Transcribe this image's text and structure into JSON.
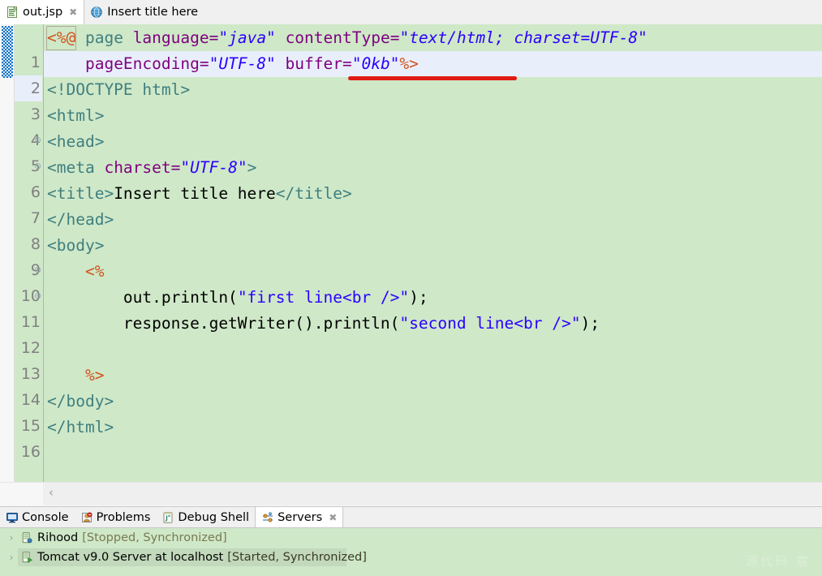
{
  "editor_tabs": [
    {
      "label": "out.jsp",
      "icon": "jsp-file-icon",
      "active": true,
      "close": "✖"
    },
    {
      "label": "Insert title here",
      "icon": "browser-globe-icon",
      "active": false,
      "close": ""
    }
  ],
  "code": {
    "lines": [
      {
        "num": "1",
        "fold": "",
        "current": false
      },
      {
        "num": "2",
        "fold": "",
        "current": true
      },
      {
        "num": "3",
        "fold": "",
        "current": false
      },
      {
        "num": "4",
        "fold": "⊝",
        "current": false
      },
      {
        "num": "5",
        "fold": "⊝",
        "current": false
      },
      {
        "num": "6",
        "fold": "",
        "current": false
      },
      {
        "num": "7",
        "fold": "",
        "current": false
      },
      {
        "num": "8",
        "fold": "",
        "current": false
      },
      {
        "num": "9",
        "fold": "⊝",
        "current": false
      },
      {
        "num": "10",
        "fold": "⊝",
        "current": false
      },
      {
        "num": "11",
        "fold": "",
        "current": false
      },
      {
        "num": "12",
        "fold": "",
        "current": false
      },
      {
        "num": "13",
        "fold": "",
        "current": false
      },
      {
        "num": "14",
        "fold": "",
        "current": false
      },
      {
        "num": "15",
        "fold": "",
        "current": false
      },
      {
        "num": "16",
        "fold": "",
        "current": false
      }
    ],
    "text": {
      "l1_open": "<%@",
      "l1_page": " page ",
      "l1_attr_language": "language=",
      "l1_val_java": "\"java\"",
      "l1_sp1": " ",
      "l1_attr_contenttype": "contentType=",
      "l1_val_contenttype": "\"text/html; charset=UTF-8\"",
      "l2_indent": "    ",
      "l2_attr_pageencoding": "pageEncoding=",
      "l2_val_utf8": "\"UTF-8\"",
      "l2_sp": " ",
      "l2_attr_buffer": "buffer=",
      "l2_val_buffer": "\"0kb\"",
      "l2_close": "%>",
      "l3": "<!DOCTYPE html>",
      "l4": "<html>",
      "l5": "<head>",
      "l6_tag_open": "<meta ",
      "l6_attr": "charset=",
      "l6_val": "\"UTF-8\"",
      "l6_tag_close": ">",
      "l7_open": "<title>",
      "l7_text": "Insert title here",
      "l7_close": "</title>",
      "l8": "</head>",
      "l9": "<body>",
      "l10": "    <%",
      "l11_pre": "        out.println(",
      "l11_str": "\"first line<br />\"",
      "l11_post": ");",
      "l12_pre": "        response.getWriter().println(",
      "l12_str": "\"second line<br />\"",
      "l12_post": ");",
      "l13": "",
      "l14": "    %>",
      "l15": "</body>",
      "l16": "</html>"
    },
    "error_underline": {
      "label": "red-squiggle-underline-buffer-attribute"
    }
  },
  "scrollbar": {
    "left_arrow": "‹"
  },
  "bottom_panel": {
    "tabs": [
      {
        "label": "Console",
        "icon": "console-icon",
        "active": false,
        "close": ""
      },
      {
        "label": "Problems",
        "icon": "problems-icon",
        "active": false,
        "close": ""
      },
      {
        "label": "Debug Shell",
        "icon": "debug-shell-icon",
        "active": false,
        "close": ""
      },
      {
        "label": "Servers",
        "icon": "servers-icon",
        "active": true,
        "close": "✖"
      }
    ],
    "servers": [
      {
        "twisty": "›",
        "icon": "server-stopped-icon",
        "name": "Rihood",
        "status": "[Stopped, Synchronized]",
        "selected": false
      },
      {
        "twisty": "›",
        "icon": "server-started-icon",
        "name": "Tomcat v9.0 Server at localhost",
        "status": "[Started, Synchronized]",
        "selected": true
      }
    ]
  },
  "watermark": {
    "text": "源代码  宸"
  },
  "colors": {
    "editor_bg": "#cfe8c8",
    "current_line": "#e8effb",
    "tag": "#3f7f7f",
    "attr": "#7f007f",
    "value": "#2a00ff",
    "jsp_delim": "#d2521d",
    "error_red": "#e01b14",
    "annotation_marker": "#0b71c5",
    "selection_bg": "#c2d9bb"
  }
}
